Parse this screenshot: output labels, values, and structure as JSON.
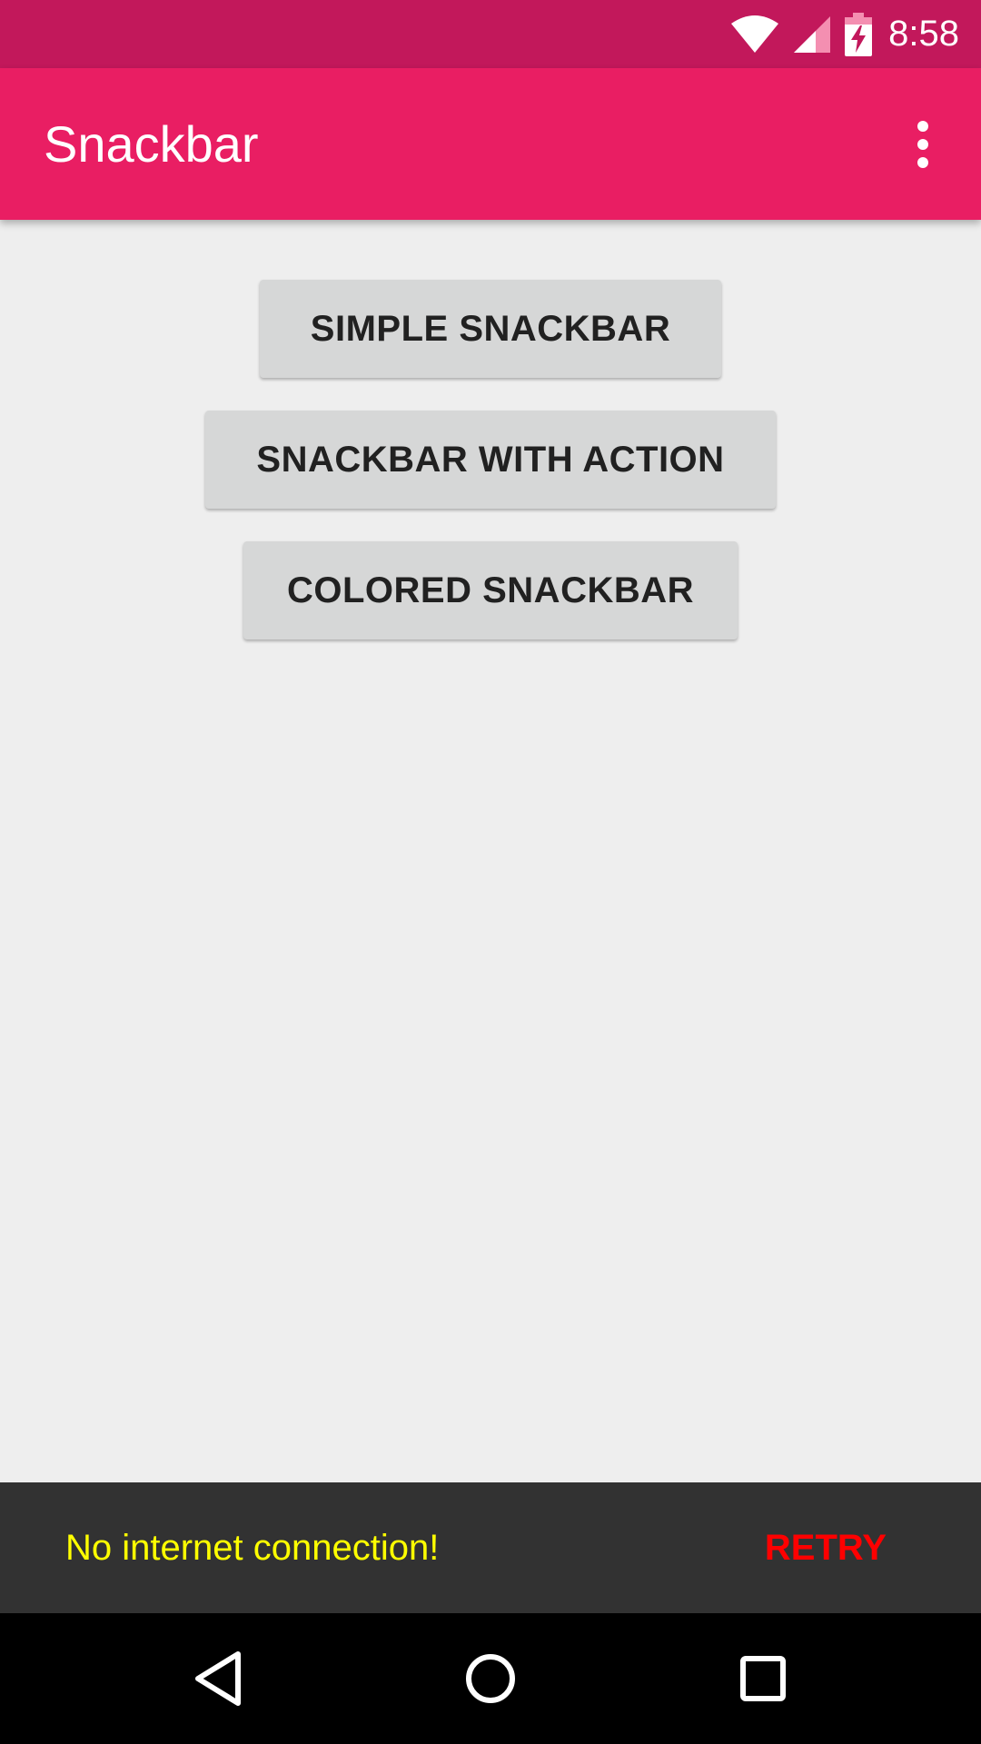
{
  "status_bar": {
    "time": "8:58",
    "icons": [
      "wifi-icon",
      "cell-signal-icon",
      "battery-charging-icon"
    ],
    "color": "#c2185b"
  },
  "app_bar": {
    "title": "Snackbar",
    "color": "#e91e63",
    "menu_icon": "overflow-menu-icon"
  },
  "main": {
    "buttons": [
      {
        "label": "SIMPLE SNACKBAR"
      },
      {
        "label": "SNACKBAR WITH ACTION"
      },
      {
        "label": "COLORED SNACKBAR"
      }
    ]
  },
  "snackbar": {
    "message": "No internet connection!",
    "action": "RETRY",
    "message_color": "#ffff00",
    "action_color": "#ff0000",
    "background": "#323232"
  },
  "nav_bar": {
    "icons": [
      "back-icon",
      "home-icon",
      "recents-icon"
    ]
  }
}
